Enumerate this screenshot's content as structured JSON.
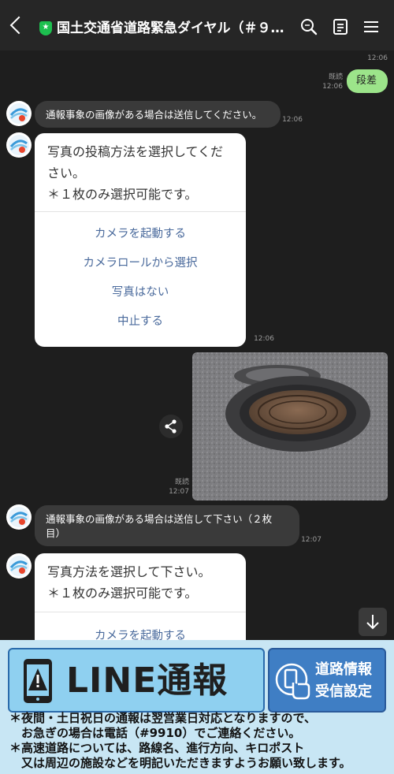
{
  "header": {
    "title": "国土交通省道路緊急ダイヤル（＃９９１０…",
    "back_icon": "back-chevron-icon",
    "verified_icon": "shield-star-icon",
    "search_icon": "search-icon",
    "notes_icon": "notes-icon",
    "menu_icon": "menu-icon"
  },
  "messages": {
    "t0": "12:06",
    "sent_1": {
      "read": "既読",
      "time": "12:06",
      "text": "段差"
    },
    "recv_1": {
      "text": "通報事象の画像がある場合は送信してください。",
      "time": "12:06"
    },
    "card_1": {
      "text_line1": "写真の投稿方法を選択してくだ",
      "text_line2": "さい。",
      "text_line3": "＊１枚のみ選択可能です。",
      "options": [
        "カメラを起動する",
        "カメラロールから選択",
        "写真はない",
        "中止する"
      ],
      "time": "12:06"
    },
    "photo": {
      "read": "既読",
      "time": "12:07"
    },
    "recv_2": {
      "line1": "通報事象の画像がある場合は送信して下さい（２枚",
      "line2": "目）",
      "time": "12:07"
    },
    "card_2": {
      "text_line1": "写真方法を選択して下さい。",
      "text_line2": "＊１枚のみ選択可能です。",
      "option_1": "カメラを起動する"
    }
  },
  "banner": {
    "line_report_label": "LINE通報",
    "road_info_label": "道路情報\n受信設定",
    "notice_1": "＊夜間・土日祝日の通報は翌営業日対応となりますので、\n　お急ぎの場合は電話（#9910）でご連絡ください。",
    "notice_2": "＊高速道路については、路線名、進行方向、キロポスト\n　又は周辺の施設などを明記いただきますようお願い致します。"
  },
  "colors": {
    "sent_bubble": "#9ce48a",
    "link_text": "#4a6a9c",
    "banner_bg": "#c8e6f4",
    "line_button": "#8fd0f0",
    "road_button": "#3f7ec4"
  }
}
